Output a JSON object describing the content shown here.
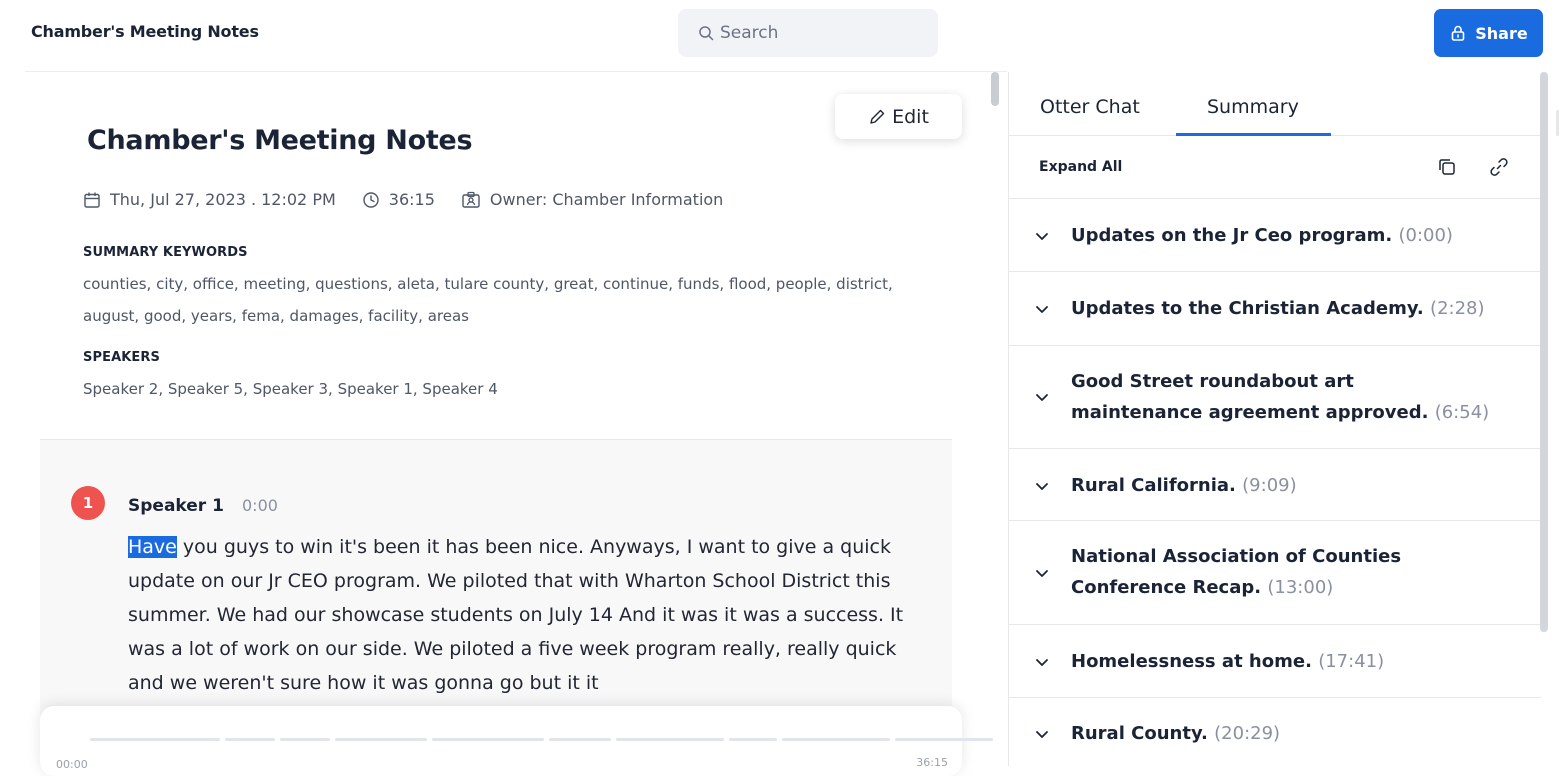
{
  "header": {
    "app_title": "Chamber's Meeting Notes",
    "search_placeholder": "Search",
    "share_label": "Share"
  },
  "document": {
    "edit_label": "Edit",
    "title": "Chamber's Meeting Notes",
    "date": "Thu, Jul 27, 2023 . 12:02 PM",
    "duration": "36:15",
    "owner": "Owner: Chamber Information",
    "keywords_label": "SUMMARY KEYWORDS",
    "keywords": "counties, city, office, meeting, questions, aleta, tulare county, great, continue, funds, flood, people, district, august, good, years, fema, damages, facility, areas",
    "speakers_label": "SPEAKERS",
    "speakers": "Speaker 2, Speaker 5, Speaker 3, Speaker 1, Speaker 4"
  },
  "transcript": {
    "avatar_number": "1",
    "speaker": "Speaker 1",
    "time": "0:00",
    "highlight_word": "Have",
    "text": " you guys to win it's been it has been nice. Anyways, I want to give a quick update on our Jr CEO program. We piloted that with Wharton School District this summer. We had our showcase students on July 14 And it was it was a success. It was a lot of work on our side. We piloted a five week program really, really quick and we weren't sure how it was gonna go but it it"
  },
  "player": {
    "start_time": "00:00",
    "end_time": "36:15"
  },
  "sidebar": {
    "tabs": [
      {
        "label": "Otter Chat",
        "active": false
      },
      {
        "label": "Summary",
        "active": true
      }
    ],
    "expand_all_label": "Expand All",
    "outline": [
      {
        "title": "Updates on the Jr Ceo program.",
        "time": "(0:00)"
      },
      {
        "title": "Updates to the Christian Academy.",
        "time": "(2:28)"
      },
      {
        "title": "Good Street roundabout art maintenance agreement approved.",
        "time": "(6:54)"
      },
      {
        "title": "Rural California.",
        "time": "(9:09)"
      },
      {
        "title": "National Association of Counties Conference Recap.",
        "time": "(13:00)"
      },
      {
        "title": "Homelessness at home.",
        "time": "(17:41)"
      },
      {
        "title": "Rural County.",
        "time": "(20:29)"
      }
    ]
  },
  "colors": {
    "accent": "#1a6be0",
    "avatar": "#ef5350",
    "text": "#1b2436",
    "muted": "#8a90a0"
  }
}
